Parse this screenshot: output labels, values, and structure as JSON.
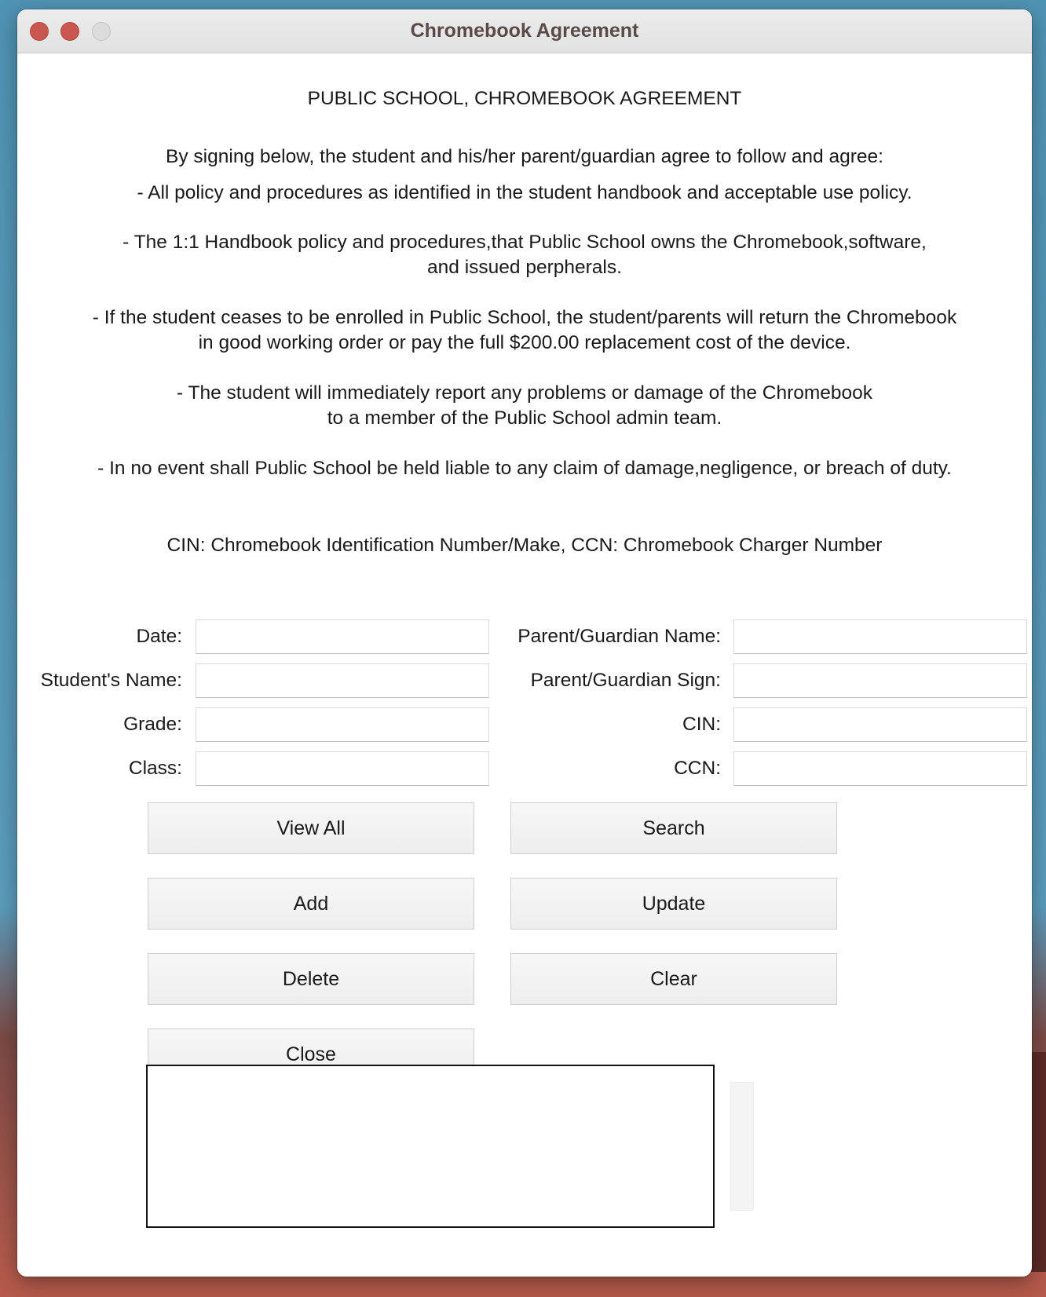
{
  "window": {
    "title": "Chromebook Agreement"
  },
  "agreement": {
    "heading": "PUBLIC SCHOOL, CHROMEBOOK AGREEMENT",
    "intro": "By signing below, the student and his/her parent/guardian agree to follow and agree:",
    "clause_1": "- All policy and procedures as identified in the student handbook and acceptable use policy.",
    "clause_2_line_1": "- The 1:1 Handbook policy and procedures,that Public School owns the Chromebook,software,",
    "clause_2_line_2": "and issued perpherals.",
    "clause_3_line_1": "- If the student ceases to be enrolled in Public School, the student/parents will return the Chromebook",
    "clause_3_line_2": "in good working order or pay the full $200.00 replacement cost of the device.",
    "clause_4_line_1": "- The student will immediately report any problems or damage of the Chromebook",
    "clause_4_line_2": "to a member of the Public School admin team.",
    "clause_5": "- In no event shall Public School be held liable to any claim of damage,negligence, or breach of duty.",
    "legend": "CIN: Chromebook Identification Number/Make, CCN: Chromebook Charger Number"
  },
  "form": {
    "date_label": "Date:",
    "student_name_label": "Student's Name:",
    "grade_label": "Grade:",
    "class_label": "Class:",
    "parent_name_label": "Parent/Guardian Name:",
    "parent_sign_label": "Parent/Guardian Sign:",
    "cin_label": "CIN:",
    "ccn_label": "CCN:",
    "date_value": "",
    "student_name_value": "",
    "grade_value": "",
    "class_value": "",
    "parent_name_value": "",
    "parent_sign_value": "",
    "cin_value": "",
    "ccn_value": ""
  },
  "buttons": {
    "view_all": "View All",
    "search": "Search",
    "add": "Add",
    "update": "Update",
    "delete": "Delete",
    "clear": "Clear",
    "close": "Close"
  },
  "colors": {
    "close_light": "#c8584f",
    "minimize_light": "#c8584f",
    "zoom_light": "#dcdcdc",
    "text": "#1a1a1a"
  }
}
